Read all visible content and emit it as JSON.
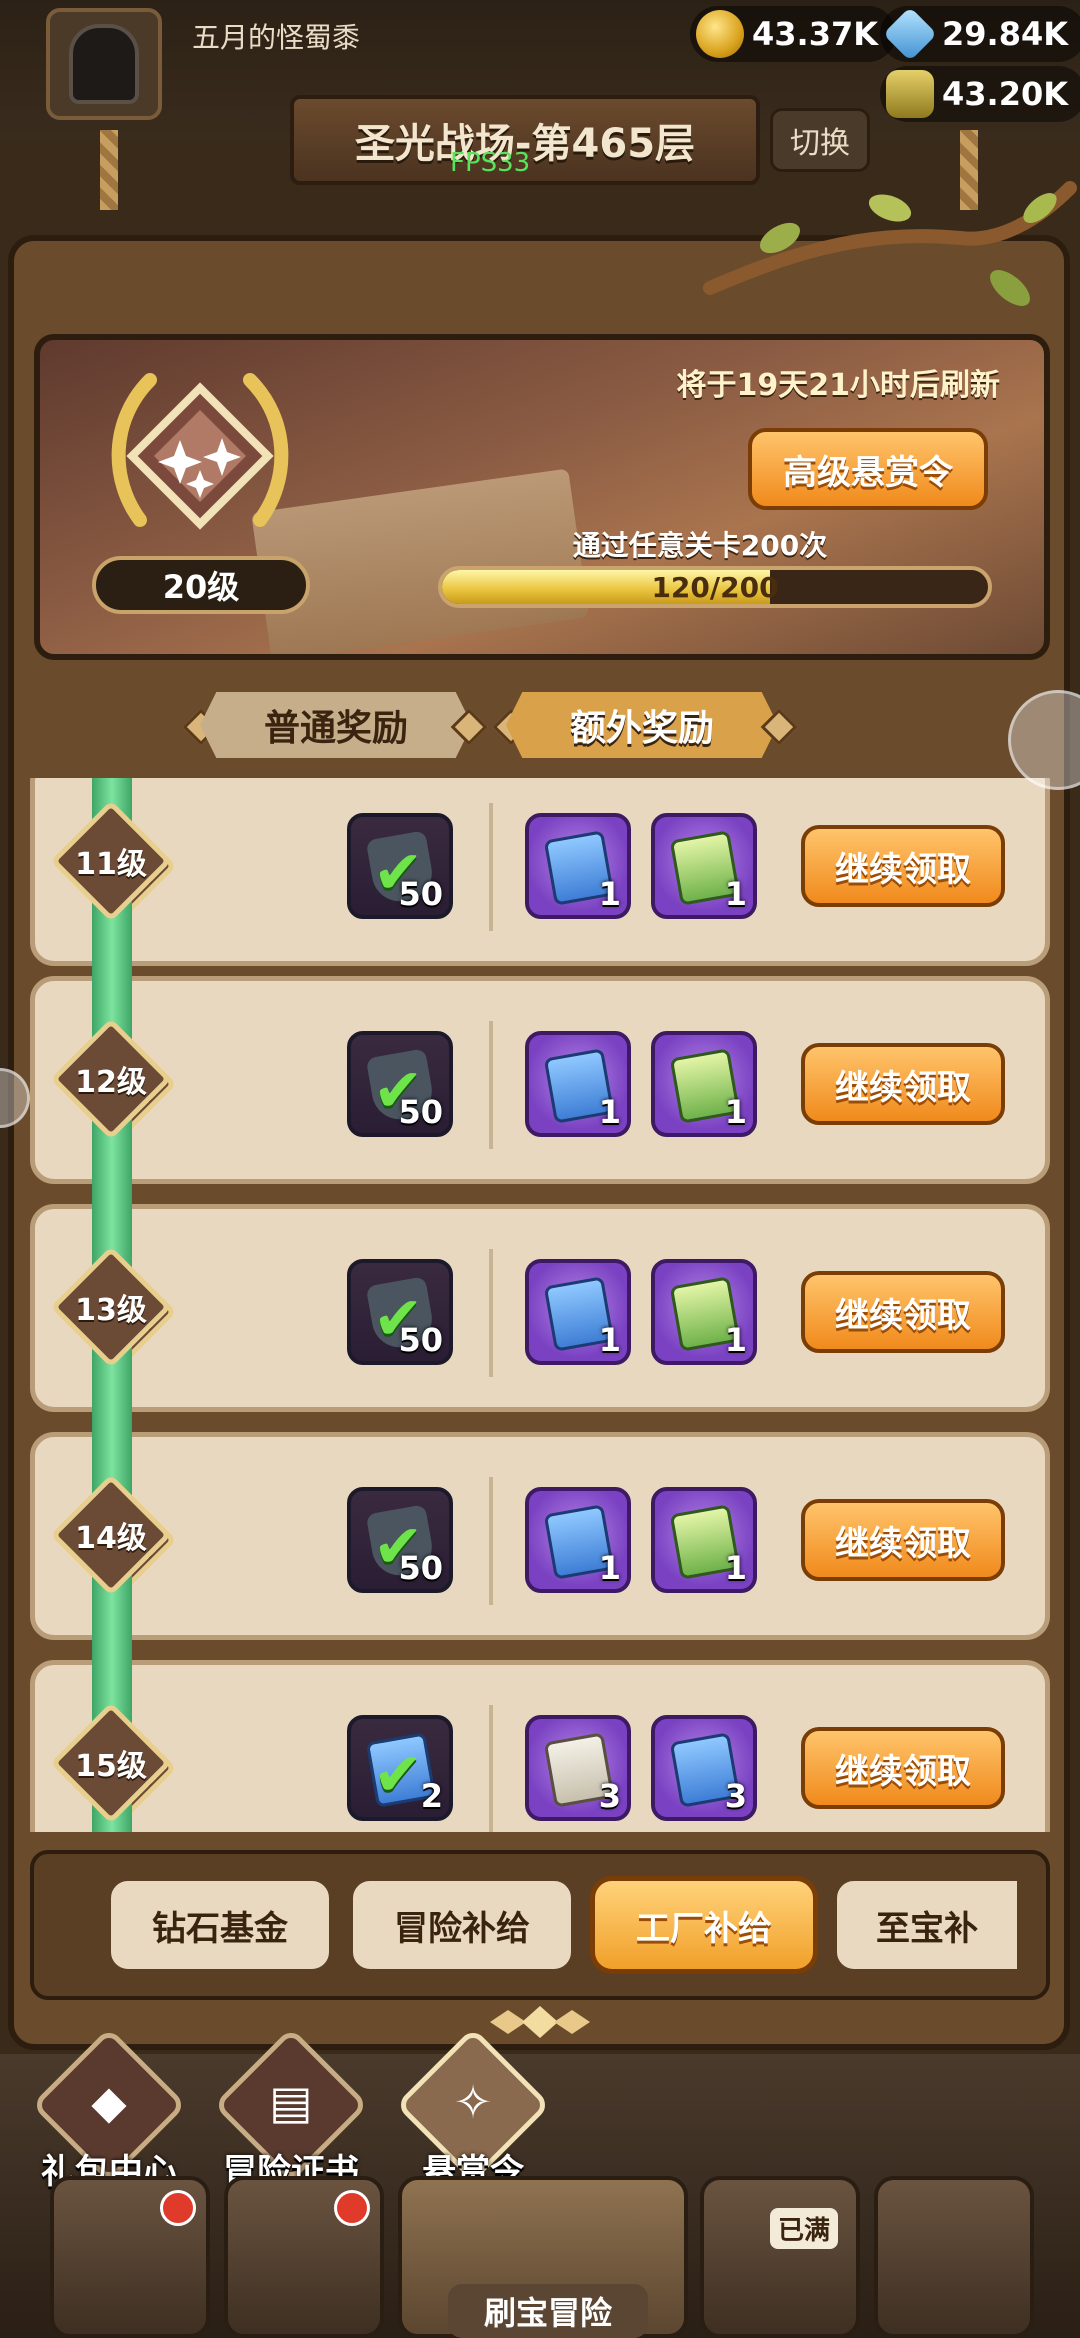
{
  "header": {
    "player_name": "五月的怪蜀黍",
    "stage_title": "圣光战场-第465层",
    "switch_label": "切换",
    "fps": "FPS33",
    "resources": [
      {
        "name": "gold",
        "icon": "coin-icon",
        "value": "43.37K"
      },
      {
        "name": "gem",
        "icon": "gem-icon",
        "value": "29.84K"
      },
      {
        "name": "potion",
        "icon": "jar-icon",
        "value": "43.20K"
      }
    ]
  },
  "hero": {
    "refresh_text": "将于19天21小时后刷新",
    "pass_button": "高级悬赏令",
    "level_label": "20级",
    "task_text": "通过任意关卡200次",
    "progress_current": 120,
    "progress_total": 200,
    "progress_label": "120/200"
  },
  "tabs": {
    "normal": "普通奖励",
    "extra": "额外奖励"
  },
  "rows": [
    {
      "level": "11级",
      "normal_qty": "50",
      "extra": [
        {
          "icon": "blue-book-icon",
          "qty": "1"
        },
        {
          "icon": "green-book-icon",
          "qty": "1"
        }
      ],
      "claim": "继续领取"
    },
    {
      "level": "12级",
      "normal_qty": "50",
      "extra": [
        {
          "icon": "blue-book-icon",
          "qty": "1"
        },
        {
          "icon": "green-book-icon",
          "qty": "1"
        }
      ],
      "claim": "继续领取"
    },
    {
      "level": "13级",
      "normal_qty": "50",
      "extra": [
        {
          "icon": "blue-book-icon",
          "qty": "1"
        },
        {
          "icon": "green-book-icon",
          "qty": "1"
        }
      ],
      "claim": "继续领取"
    },
    {
      "level": "14级",
      "normal_qty": "50",
      "extra": [
        {
          "icon": "blue-book-icon",
          "qty": "1"
        },
        {
          "icon": "green-book-icon",
          "qty": "1"
        }
      ],
      "claim": "继续领取"
    },
    {
      "level": "15级",
      "normal_qty": "2",
      "extra": [
        {
          "icon": "paper-icon",
          "qty": "3"
        },
        {
          "icon": "blue-book-icon",
          "qty": "3"
        }
      ],
      "claim": "继续领取"
    }
  ],
  "categories": [
    {
      "label": "钻石基金",
      "active": false
    },
    {
      "label": "冒险补给",
      "active": false
    },
    {
      "label": "工厂补给",
      "active": true
    },
    {
      "label": "至宝补",
      "active": false
    }
  ],
  "side_buttons": [
    {
      "label": "礼包中心",
      "icon": "diamond-icon"
    },
    {
      "label": "冒险证书",
      "icon": "book-icon"
    },
    {
      "label": "悬赏令",
      "icon": "bounty-icon"
    }
  ],
  "bottom_nav": {
    "main_label": "刷宝冒险",
    "full_tag": "已满"
  },
  "colors": {
    "accent_orange": "#f08a1c",
    "panel_brown": "#6a4b2c",
    "track_green": "#7de39f",
    "check_green": "#6ee34a"
  }
}
